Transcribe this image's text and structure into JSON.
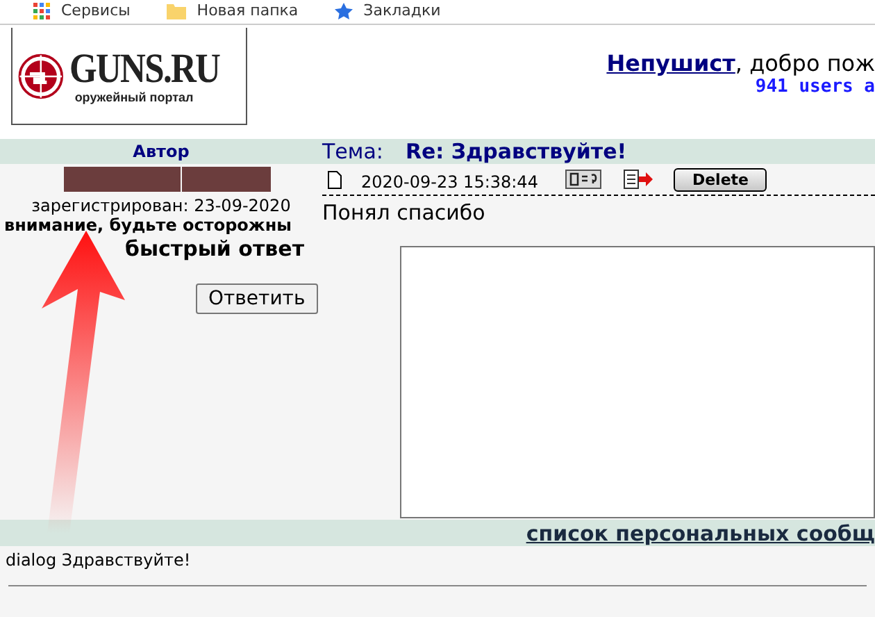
{
  "bookmarks_bar": {
    "items": [
      {
        "label": "Сервисы",
        "kind": "apps"
      },
      {
        "label": "Новая папка",
        "kind": "folder"
      },
      {
        "label": "Закладки",
        "kind": "star"
      }
    ]
  },
  "header": {
    "logo": {
      "title": "GUNS.RU",
      "subtitle": "оружейный портал"
    },
    "greeting": {
      "username": "Непушист",
      "text": ", добро пож"
    },
    "online": "941 users a"
  },
  "message": {
    "author_heading": "Автор",
    "topic_label": "Тема:",
    "topic": "Re: Здравствуйте!",
    "registered": "зарегистрирован: 23-09-2020",
    "warning": "внимание, будьте осторожны",
    "timestamp": "2020-09-23 15:38:44",
    "delete_button": "Delete",
    "body": "Понял спасибо"
  },
  "quick_reply": {
    "title": "быстрый ответ",
    "reply_button": "Ответить"
  },
  "messages_list": {
    "link": "список персональных сообщ",
    "items": [
      "dialog Здравствуйте!"
    ]
  }
}
